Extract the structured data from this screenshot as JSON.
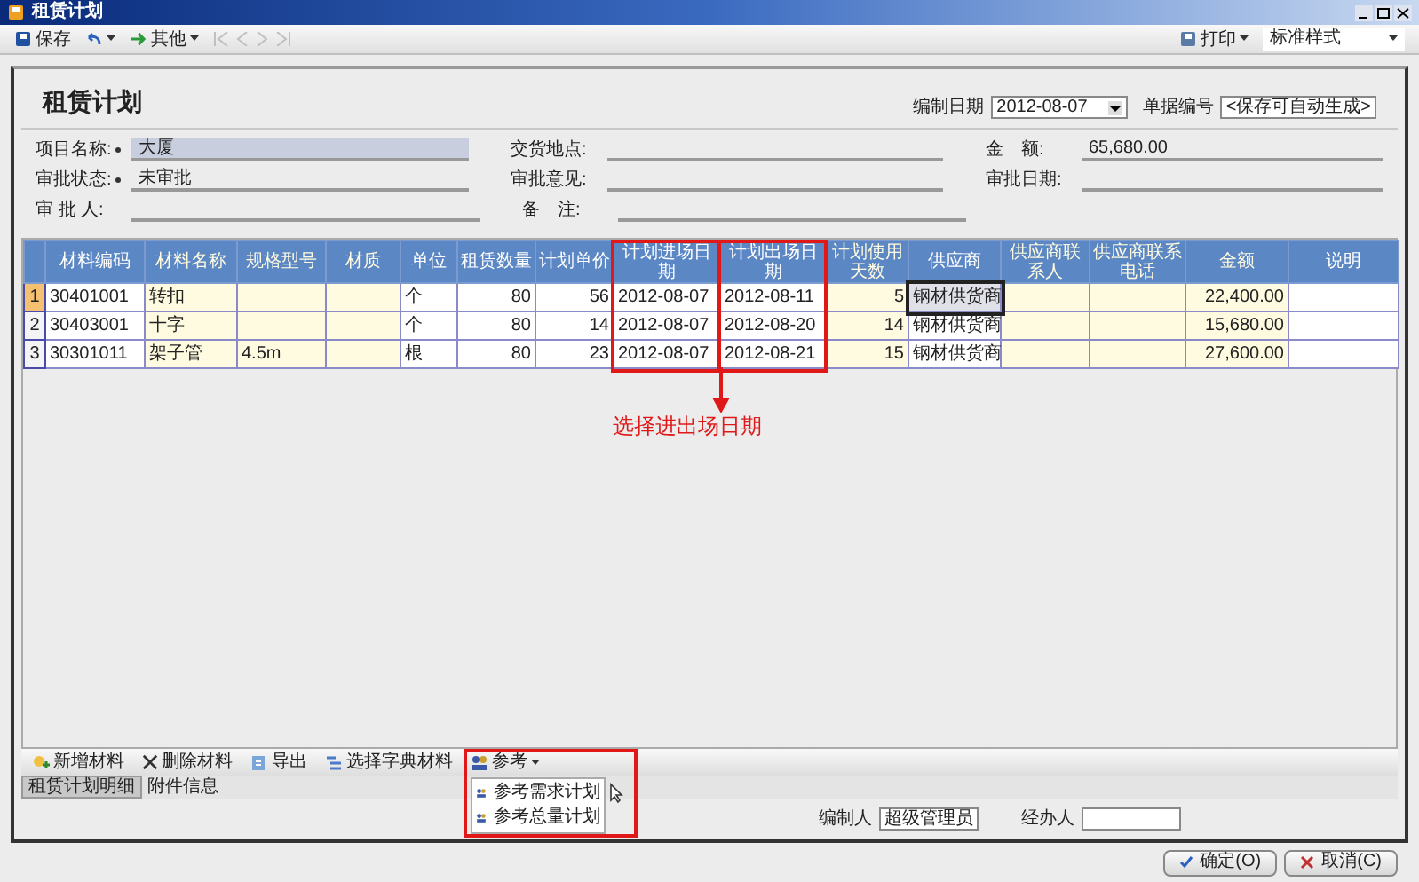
{
  "window": {
    "title": "租赁计划"
  },
  "toolbar": {
    "save": "保存",
    "other": "其他",
    "print": "打印",
    "style": "标准样式"
  },
  "heading": "租赁计划",
  "header_fields": [
    {
      "label": "编制日期",
      "value": "2012-08-07",
      "kind": "date"
    },
    {
      "label": "单据编号",
      "value": "<保存可自动生成>",
      "kind": "text"
    }
  ],
  "form_rows": [
    [
      {
        "label": "项目名称:",
        "required": true,
        "value": "大厦",
        "highlight": true
      },
      {
        "label": "交货地点:"
      },
      {
        "label": "金　额:",
        "value": "65,680.00"
      }
    ],
    [
      {
        "label": "审批状态:",
        "required": true,
        "value": "未审批",
        "highlight": false
      },
      {
        "label": "审批意见:"
      },
      {
        "label": "审批日期:"
      }
    ],
    [
      {
        "label": "审 批 人:",
        "required": false,
        "highlight": false
      },
      {
        "label": "备　注:"
      }
    ]
  ],
  "table": {
    "columns": [
      {
        "label": "材料编码",
        "editable": false,
        "highlighted": false
      },
      {
        "label": "材料名称",
        "editable": true,
        "highlighted": false
      },
      {
        "label": "规格型号",
        "editable": true,
        "highlighted": false
      },
      {
        "label": "材质",
        "editable": true,
        "highlighted": false
      },
      {
        "label": "单位",
        "editable": false,
        "highlighted": false
      },
      {
        "label": "租赁数量",
        "editable": false,
        "highlighted": false
      },
      {
        "label": "计划单价",
        "editable": false,
        "highlighted": false
      },
      {
        "label": "计划进场日期",
        "editable": false,
        "highlighted": true
      },
      {
        "label": "计划出场日期",
        "editable": false,
        "highlighted": true
      },
      {
        "label": "计划使用天数",
        "editable": true,
        "highlighted": false
      },
      {
        "label": "供应商",
        "editable": false,
        "highlighted": false
      },
      {
        "label": "供应商联系人",
        "editable": true,
        "highlighted": false
      },
      {
        "label": "供应商联系电话",
        "editable": true,
        "highlighted": false
      },
      {
        "label": "金额",
        "editable": true,
        "highlighted": false
      },
      {
        "label": "说明",
        "editable": false,
        "highlighted": false
      }
    ],
    "rows": [
      {
        "index": "1",
        "selected": true,
        "cells": [
          "30401001",
          "转扣",
          "",
          "",
          "个",
          "80",
          "56",
          "2012-08-07",
          "2012-08-11",
          "5",
          "钢材供货商",
          "",
          "",
          "22,400.00",
          ""
        ]
      },
      {
        "index": "2",
        "selected": false,
        "cells": [
          "30403001",
          "十字",
          "",
          "",
          "个",
          "80",
          "14",
          "2012-08-07",
          "2012-08-20",
          "14",
          "钢材供货商",
          "",
          "",
          "15,680.00",
          ""
        ]
      },
      {
        "index": "3",
        "selected": false,
        "cells": [
          "30301011",
          "架子管",
          "4.5m",
          "",
          "根",
          "80",
          "23",
          "2012-08-07",
          "2012-08-21",
          "15",
          "钢材供货商",
          "",
          "",
          "27,600.00",
          ""
        ]
      }
    ]
  },
  "annotation": "选择进出场日期",
  "grid_toolbar": {
    "buttons": [
      {
        "label": "新增材料",
        "kind": "add"
      },
      {
        "label": "删除材料",
        "kind": "delete"
      },
      {
        "label": "导出",
        "kind": "export"
      },
      {
        "label": "选择字典材料",
        "kind": "pick"
      },
      {
        "label": "参考",
        "kind": "menu"
      }
    ],
    "menu": [
      "参考需求计划",
      "参考总量计划"
    ]
  },
  "tabs": [
    {
      "label": "租赁计划明细",
      "selected": true
    },
    {
      "label": "附件信息",
      "selected": false
    }
  ],
  "footer_fields": [
    {
      "label": "编制人",
      "value": "超级管理员"
    },
    {
      "label": "经办人"
    }
  ],
  "buttons": [
    "确定(O)",
    "取消(C)"
  ]
}
